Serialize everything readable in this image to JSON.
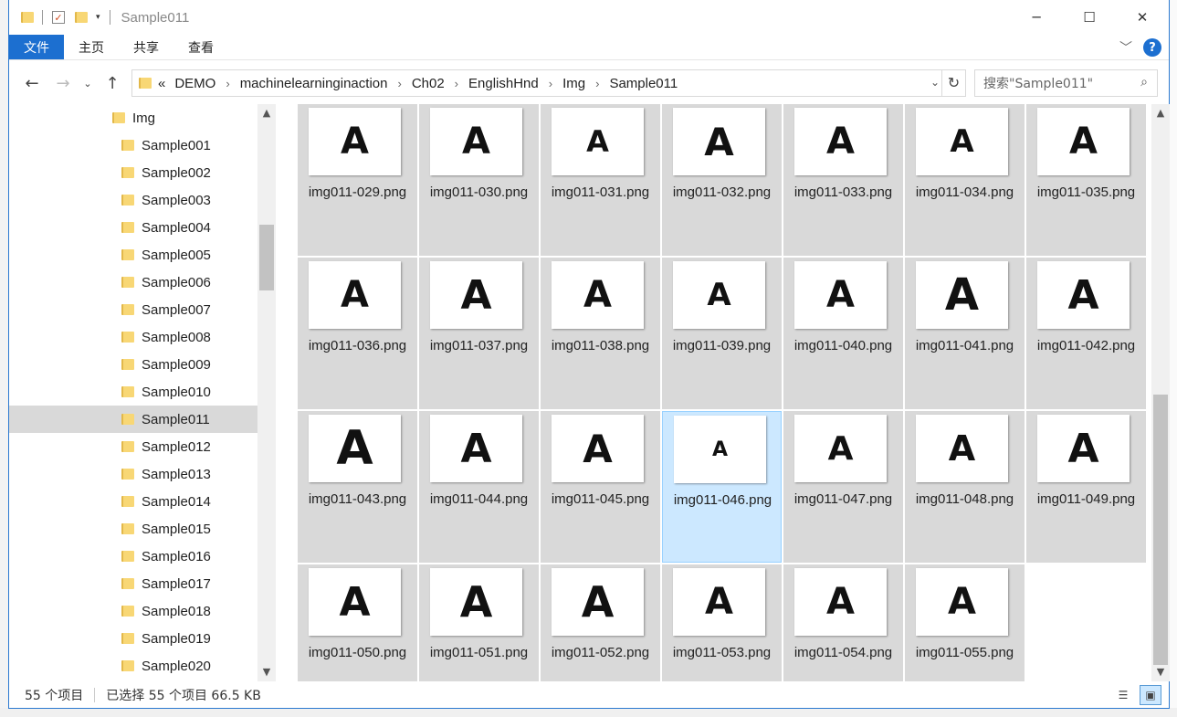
{
  "window": {
    "title": "Sample011"
  },
  "ribbon": {
    "tabs": [
      "文件",
      "主页",
      "共享",
      "查看"
    ]
  },
  "address": {
    "overflow": "«",
    "crumbs": [
      "DEMO",
      "machinelearninginaction",
      "Ch02",
      "EnglishHnd",
      "Img",
      "Sample011"
    ]
  },
  "search": {
    "placeholder": "搜索\"Sample011\""
  },
  "navpane": {
    "parent": "Img",
    "items": [
      "Sample001",
      "Sample002",
      "Sample003",
      "Sample004",
      "Sample005",
      "Sample006",
      "Sample007",
      "Sample008",
      "Sample009",
      "Sample010",
      "Sample011",
      "Sample012",
      "Sample013",
      "Sample014",
      "Sample015",
      "Sample016",
      "Sample017",
      "Sample018",
      "Sample019",
      "Sample020"
    ],
    "selected": "Sample011"
  },
  "files": [
    {
      "name": "img011-029.png",
      "glyph": "A",
      "scale": 1.0
    },
    {
      "name": "img011-030.png",
      "glyph": "A",
      "scale": 1.0
    },
    {
      "name": "img011-031.png",
      "glyph": "A",
      "scale": 0.8
    },
    {
      "name": "img011-032.png",
      "glyph": "A",
      "scale": 1.05
    },
    {
      "name": "img011-033.png",
      "glyph": "A",
      "scale": 1.0
    },
    {
      "name": "img011-034.png",
      "glyph": "A",
      "scale": 0.85
    },
    {
      "name": "img011-035.png",
      "glyph": "A",
      "scale": 1.0
    },
    {
      "name": "img011-036.png",
      "glyph": "A",
      "scale": 1.0
    },
    {
      "name": "img011-037.png",
      "glyph": "A",
      "scale": 1.1
    },
    {
      "name": "img011-038.png",
      "glyph": "A",
      "scale": 1.0
    },
    {
      "name": "img011-039.png",
      "glyph": "A",
      "scale": 0.85
    },
    {
      "name": "img011-040.png",
      "glyph": "A",
      "scale": 1.0
    },
    {
      "name": "img011-041.png",
      "glyph": "A",
      "scale": 1.2
    },
    {
      "name": "img011-042.png",
      "glyph": "A",
      "scale": 1.1
    },
    {
      "name": "img011-043.png",
      "glyph": "A",
      "scale": 1.3
    },
    {
      "name": "img011-044.png",
      "glyph": "A",
      "scale": 1.1
    },
    {
      "name": "img011-045.png",
      "glyph": "A",
      "scale": 1.05
    },
    {
      "name": "img011-046.png",
      "glyph": "A",
      "scale": 0.55
    },
    {
      "name": "img011-047.png",
      "glyph": "A",
      "scale": 0.9
    },
    {
      "name": "img011-048.png",
      "glyph": "A",
      "scale": 0.95
    },
    {
      "name": "img011-049.png",
      "glyph": "A",
      "scale": 1.1
    },
    {
      "name": "img011-050.png",
      "glyph": "A",
      "scale": 1.1
    },
    {
      "name": "img011-051.png",
      "glyph": "A",
      "scale": 1.15
    },
    {
      "name": "img011-052.png",
      "glyph": "A",
      "scale": 1.15
    },
    {
      "name": "img011-053.png",
      "glyph": "A",
      "scale": 1.0
    },
    {
      "name": "img011-054.png",
      "glyph": "A",
      "scale": 1.0
    },
    {
      "name": "img011-055.png",
      "glyph": "A",
      "scale": 1.0
    }
  ],
  "selected_file": "img011-046.png",
  "status": {
    "count": "55 个项目",
    "selection": "已选择 55 个项目  66.5 KB"
  },
  "colors": {
    "accent": "#1c6fd0",
    "tile_bg": "#d9d9d9",
    "tile_selected": "#cce8ff"
  }
}
